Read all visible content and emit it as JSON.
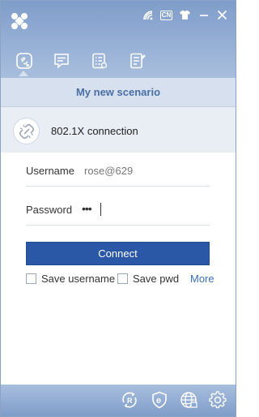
{
  "header": {
    "logo_icon": "app-logo",
    "top_icons": [
      "wifi-icon",
      "language-cn-badge",
      "theme-shirt-icon",
      "minimize-icon",
      "close-icon"
    ],
    "language_badge": "CN"
  },
  "tabs": [
    {
      "name": "connection-tab",
      "icon": "link-refresh-icon",
      "active": true
    },
    {
      "name": "messages-tab",
      "icon": "message-icon"
    },
    {
      "name": "list-tab",
      "icon": "list-icon"
    },
    {
      "name": "notes-tab",
      "icon": "edit-note-icon"
    }
  ],
  "scenario": {
    "title": "My new scenario"
  },
  "connection": {
    "type_label": "802.1X connection",
    "icon": "broken-link-icon"
  },
  "form": {
    "username_label": "Username",
    "username_value": "rose@629",
    "password_label": "Password",
    "password_mask": "•••",
    "connect_label": "Connect",
    "save_username_label": "Save username",
    "save_pwd_label": "Save pwd",
    "more_label": "More"
  },
  "footer": {
    "icons": [
      "r-refresh-icon",
      "shield-e-icon",
      "globe-icon",
      "settings-gear-icon"
    ]
  },
  "colors": {
    "header_gradient_top": "#7f9dca",
    "header_gradient_bottom": "#a8bedd",
    "accent": "#2a58a6",
    "scenario_text": "#4a6fa5",
    "link": "#3c6eb4"
  }
}
